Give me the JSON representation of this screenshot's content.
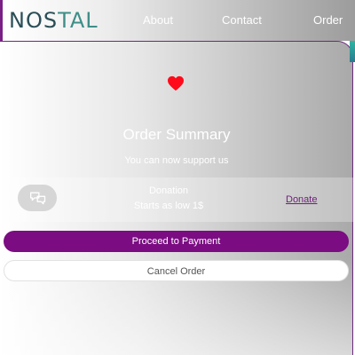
{
  "nav": {
    "logo_part1": "NOS",
    "logo_part2": "TAL",
    "links": [
      "About",
      "Contact",
      "Order"
    ]
  },
  "order": {
    "heart_icon": "heart-icon",
    "title": "Order Summary",
    "subtitle": "You can now support us",
    "donation": {
      "icon": "chat-bubbles-icon",
      "title": "Donation",
      "subtitle": "Starts as low 1$",
      "link": "Donate"
    },
    "proceed_label": "Proceed to Payment",
    "cancel_label": "Cancel Order"
  },
  "colors": {
    "accent": "#7b0c82",
    "heart": "#ff0a1a",
    "logo": "#2b4e57"
  }
}
